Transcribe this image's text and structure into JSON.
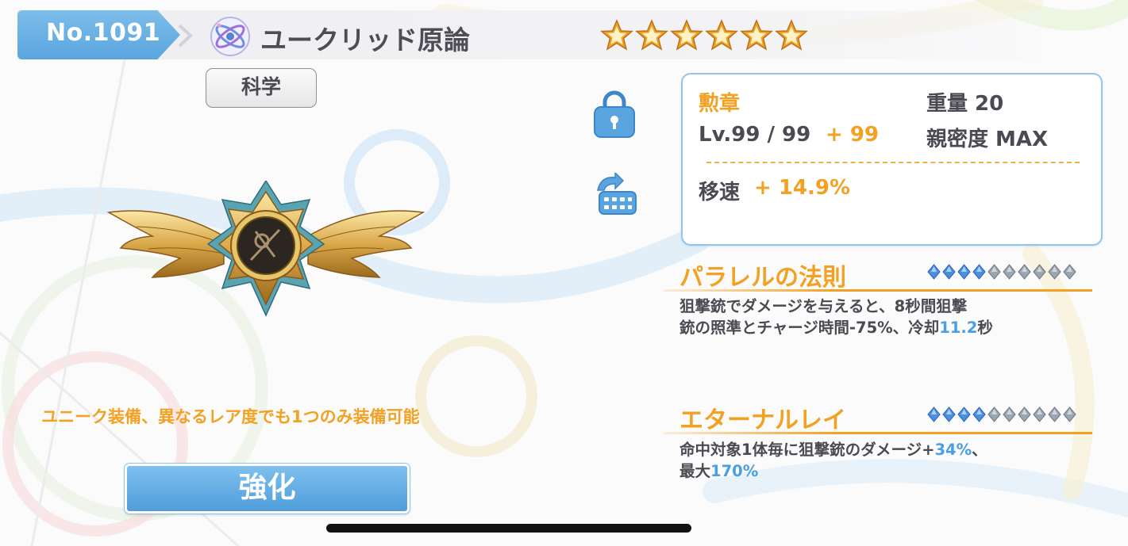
{
  "header": {
    "number": "No.1091",
    "title": "ユークリッド原論",
    "icon": "atom-icon",
    "stars": 6,
    "star_color": "#f3a123"
  },
  "category": "科学",
  "unique_note": "ユニーク装備、異なるレア度でも1つのみ装備可能",
  "enhance_button": "強化",
  "info": {
    "type": "勲章",
    "weight": "重量 20",
    "level": "Lv.99 / 99",
    "level_bonus": "+ 99",
    "affinity": "親密度 MAX",
    "stat_label": "移速",
    "stat_value": "+ 14.9%"
  },
  "skills": [
    {
      "name": "パラレルの法則",
      "filled": 4,
      "total": 10,
      "desc_line1": "狙撃銃でダメージを与えると、8秒間狙撃",
      "desc_line2_a": "銃の照準とチャージ時間-75%、冷却",
      "desc_line2_b": "11.2",
      "desc_line2_c": "秒"
    },
    {
      "name": "エターナルレイ",
      "filled": 4,
      "total": 10,
      "desc_line1_a": "命中対象1体毎に狙撃銃のダメージ+",
      "desc_line1_b": "34%",
      "desc_line1_c": "、",
      "desc_line2_a": "最大",
      "desc_line2_b": "170%"
    }
  ],
  "colors": {
    "accent_blue": "#5aa5df",
    "accent_orange": "#f3a123",
    "text_dark": "#4a4a52"
  }
}
